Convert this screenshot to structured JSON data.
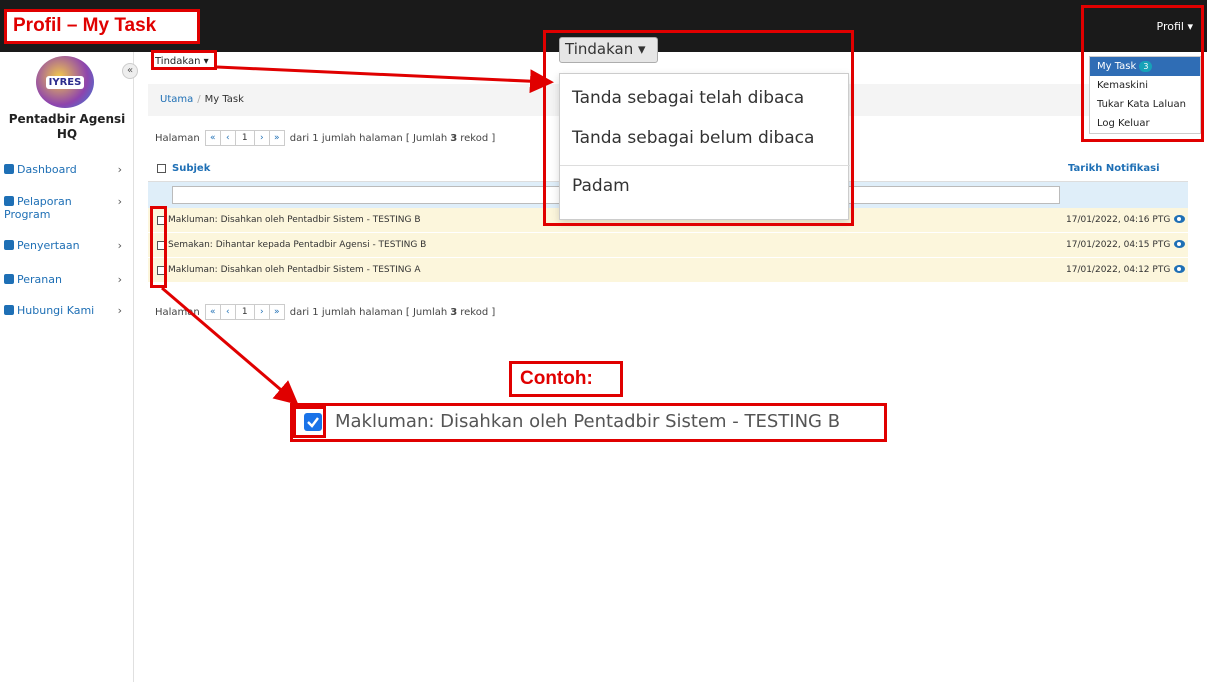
{
  "annotations": {
    "title": "Profil – My Task",
    "contoh": "Contoh:"
  },
  "topbar": {
    "profil": "Profil ▾"
  },
  "sidebar": {
    "collapse": "«",
    "logo_text": "IYRES",
    "agency": "Pentadbir Agensi HQ",
    "items": [
      {
        "label": "Dashboard",
        "label2": ""
      },
      {
        "label": "Pelaporan",
        "label2": "Program"
      },
      {
        "label": "Penyertaan",
        "label2": ""
      },
      {
        "label": "Peranan",
        "label2": ""
      },
      {
        "label": "Hubungi Kami",
        "label2": ""
      }
    ]
  },
  "main": {
    "tindakan_small": "Tindakan ▾",
    "breadcrumb": {
      "home": "Utama",
      "sep": "/",
      "current": "My Task"
    },
    "pager": {
      "label": "Halaman",
      "first": "«",
      "prev": "‹",
      "page": "1",
      "next": "›",
      "last": "»",
      "of_text": "dari 1 jumlah halaman [ Jumlah",
      "count": "3",
      "rekod": "rekod ]"
    },
    "table": {
      "col_subject": "Subjek",
      "col_date": "Tarikh Notifikasi",
      "rows": [
        {
          "subject": "Makluman: Disahkan oleh Pentadbir Sistem - TESTING B",
          "date": "17/01/2022, 04:16 PTG"
        },
        {
          "subject": "Semakan: Dihantar kepada Pentadbir Agensi - TESTING B",
          "date": "17/01/2022, 04:15 PTG"
        },
        {
          "subject": "Makluman: Disahkan oleh Pentadbir Sistem - TESTING A",
          "date": "17/01/2022, 04:12 PTG"
        }
      ]
    }
  },
  "profile_menu": {
    "items": [
      {
        "label": "My Task",
        "badge": "3"
      },
      {
        "label": "Kemaskini"
      },
      {
        "label": "Tukar Kata Laluan"
      },
      {
        "label": "Log Keluar"
      }
    ]
  },
  "tindakan_dropdown": {
    "button": "Tindakan ▾",
    "items": [
      "Tanda sebagai telah dibaca",
      "Tanda sebagai belum dibaca",
      "Padam"
    ]
  },
  "example": {
    "text": "Makluman: Disahkan oleh Pentadbir Sistem - TESTING B"
  },
  "colors": {
    "annotation_red": "#e00000",
    "link_blue": "#1e6fb5",
    "row_yellow": "#fcf6dc",
    "checkbox_blue": "#1a73e8"
  }
}
